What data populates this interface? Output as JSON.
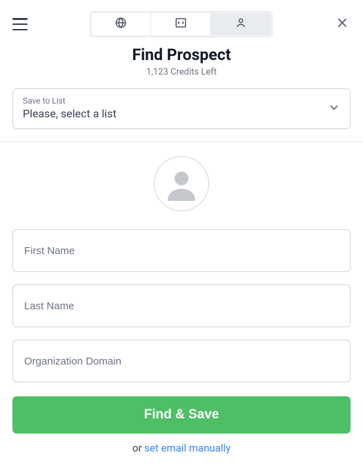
{
  "header": {
    "title": "Find Prospect",
    "credits_text": "1,123 Credits Left"
  },
  "tabs": {
    "globe_icon": "globe-icon",
    "code_icon": "code-icon",
    "person_icon": "person-icon",
    "active_index": 2
  },
  "save_list": {
    "label": "Save to List",
    "value": "Please, select a list"
  },
  "form": {
    "first_name_placeholder": "First Name",
    "last_name_placeholder": "Last Name",
    "org_placeholder": "Organization Domain",
    "first_name": "",
    "last_name": "",
    "org": ""
  },
  "actions": {
    "primary": "Find & Save",
    "or_text": "or ",
    "manual_link": "set email manually"
  },
  "colors": {
    "accent": "#4fbf67",
    "link": "#3b82f6"
  }
}
